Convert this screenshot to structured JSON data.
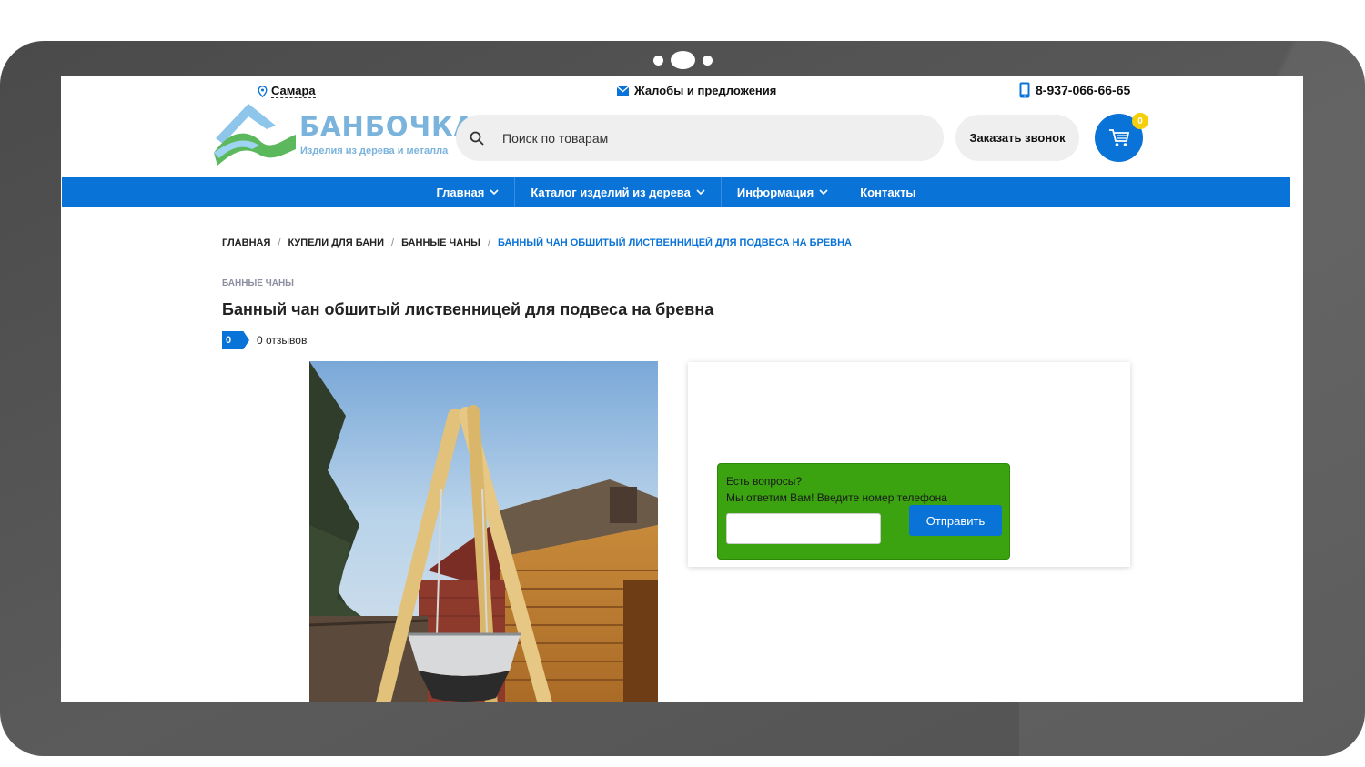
{
  "topbar": {
    "city": "Самара",
    "complaints": "Жалобы и предложения",
    "phone": "8-937-066-66-65"
  },
  "logo": {
    "title": "БАНБОЧКА",
    "subtitle": "Изделия из дерева и металла"
  },
  "search": {
    "placeholder": "Поиск по товарам"
  },
  "callback_button": "Заказать звонок",
  "cart": {
    "count": "0"
  },
  "nav": [
    {
      "label": "Главная",
      "has_dropdown": true
    },
    {
      "label": "Каталог изделий из дерева",
      "has_dropdown": true
    },
    {
      "label": "Информация",
      "has_dropdown": true
    },
    {
      "label": "Контакты",
      "has_dropdown": false
    }
  ],
  "breadcrumb": [
    "Главная",
    "Купели для бани",
    "Банные чаны",
    "Банный чан обшитый лиственницей для подвеса на бревна"
  ],
  "category": "БАННЫЕ ЧАНЫ",
  "product": {
    "title": "Банный чан обшитый лиственницей для подвеса на бревна",
    "rating": "0",
    "reviews": "0 отзывов"
  },
  "callback_form": {
    "line1": "Есть вопросы?",
    "line2": "Мы ответим Вам! Введите номер телефона",
    "submit": "Отправить"
  },
  "colors": {
    "brand_blue": "#0a73d7",
    "form_green": "#3aa30f",
    "badge_yellow": "#f4cf0a"
  }
}
